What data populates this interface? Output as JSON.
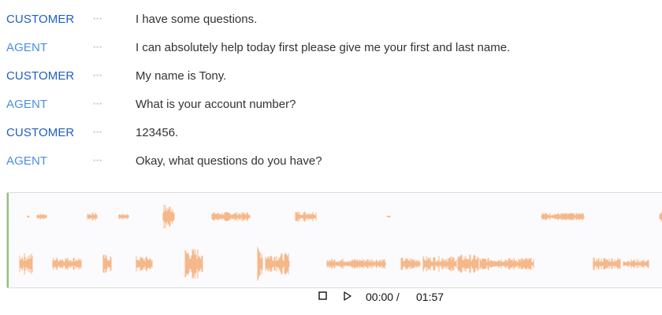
{
  "transcript": [
    {
      "speaker": "CUSTOMER",
      "dots": "•••",
      "message": "I have some questions."
    },
    {
      "speaker": "AGENT",
      "dots": "•••",
      "message": "I can absolutely help today first please give me your first and last name."
    },
    {
      "speaker": "CUSTOMER",
      "dots": "•••",
      "message": "My name is Tony."
    },
    {
      "speaker": "AGENT",
      "dots": "•••",
      "message": "What is your account number?"
    },
    {
      "speaker": "CUSTOMER",
      "dots": "•••",
      "message": "123456."
    },
    {
      "speaker": "AGENT",
      "dots": "•••",
      "message": "Okay, what questions do you have?"
    }
  ],
  "player": {
    "current_time": "00:00 /",
    "duration": "01:57",
    "stop_icon": "stop-icon",
    "play_icon": "play-icon"
  },
  "colors": {
    "customer": "#1e5fc4",
    "agent": "#4b8de6",
    "waveform": "#f5b88a",
    "progress_cursor": "#8dc277"
  }
}
